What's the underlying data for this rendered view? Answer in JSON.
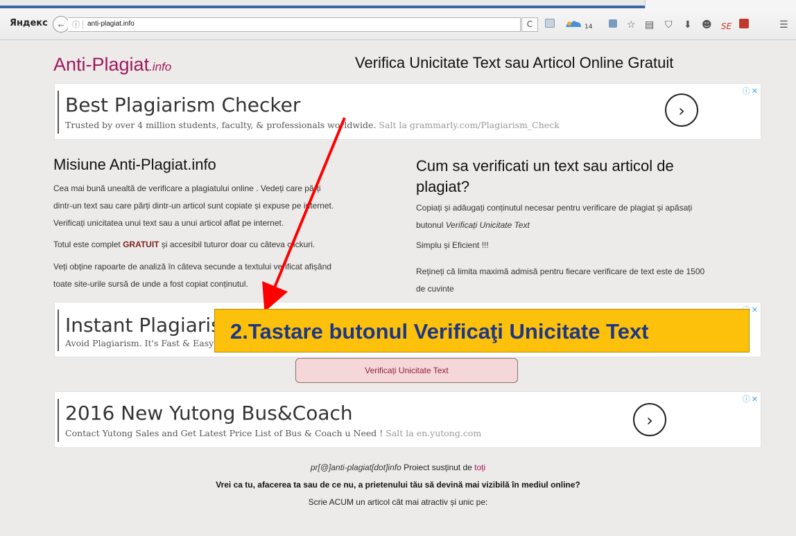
{
  "browser": {
    "brand": "Яндекс",
    "back_glyph": "←",
    "info_glyph": "ⓘ",
    "url": "anti-plagiat.info",
    "reload_glyph": "C",
    "cloud_count": "14",
    "icons": [
      "reader-view-icon",
      "cloud-icon",
      "screenshot-icon",
      "bookmark-star-icon",
      "bookmarks-list-icon",
      "pocket-icon",
      "download-icon",
      "chat-icon",
      "seo-icon",
      "extension-icon",
      "menu-icon"
    ]
  },
  "site": {
    "logo_main": "Anti-Plagiat",
    "logo_sub": ".info",
    "tagline": "Verifica Unicitate Text sau Articol Online Gratuit"
  },
  "ads": [
    {
      "headline": "Best Plagiarism Checker",
      "desc": "Trusted by over 4 million students, faculty, & professionals worldwide.",
      "link": "Salt la grammarly.com/Plagiarism_Check",
      "arrow": "›"
    },
    {
      "headline": "Instant Plagiarism",
      "desc": "Avoid Plagiarism. It's Fast & Easy"
    },
    {
      "headline": "2016 New Yutong Bus&Coach",
      "desc": "Contact Yutong Sales and Get Latest Price List of Bus & Coach u Need !",
      "link": "Salt la en.yutong.com",
      "arrow": "›"
    }
  ],
  "adchoices": "ⓘ",
  "adclose": "✕",
  "mission": {
    "title": "Misiune Anti-Plagiat.info",
    "p1_l1": "Cea mai bună unealtă de verificare a plagiatului online . Vedeți care părți",
    "p1_l2": "dintr-un text sau care părți dintr-un articol sunt copiate și expuse pe internet.",
    "p1_l3": "Verificați unicitatea unui text sau a unui articol aflat pe internet.",
    "p2_pre": "Totul este complet ",
    "p2_bold": "GRATUIT",
    "p2_post": " și accesibil tuturor doar cu câteva clickuri.",
    "p3_l1": "Veți obține rapoarte de analiză în câteva secunde a textului verificat afișând",
    "p3_l2": "toate site-urile sursă de unde a fost copiat conținutul."
  },
  "howto": {
    "title_l1": "Cum sa verificati un text sau articol de",
    "title_l2": "plagiat?",
    "p1_l1": "Copiați și adăugați conținutul necesar pentru verificare de plagiat și apăsați",
    "p1_l2_pre": "butonul ",
    "p1_l2_italic": "Verificați Unicitate Text",
    "p2": "Simplu și Eficient !!!",
    "p3_l1": "Rețineți că limita maximă admisă pentru fiecare verificare de text este de 1500",
    "p3_l2": "de cuvinte"
  },
  "verify_button": "Verificați Unicitate Text",
  "footer": {
    "email": "pr[@]anti-plagiat[dot]info",
    "supported": " Proiect susținut de ",
    "supported_link": "toți",
    "question": "Vrei ca tu, afacerea ta sau de ce nu, a prietenului tău să devină mai vizibilă în mediul online?",
    "cta": "Scrie ACUM un articol cât mai atractiv și unic pe:"
  },
  "annotation": {
    "callout": "2.Tastare butonul Verificaţi Unicitate Text",
    "arrow_color": "#ff0000",
    "callout_bg": "#fdc00b",
    "callout_text_color": "#1d3785"
  }
}
